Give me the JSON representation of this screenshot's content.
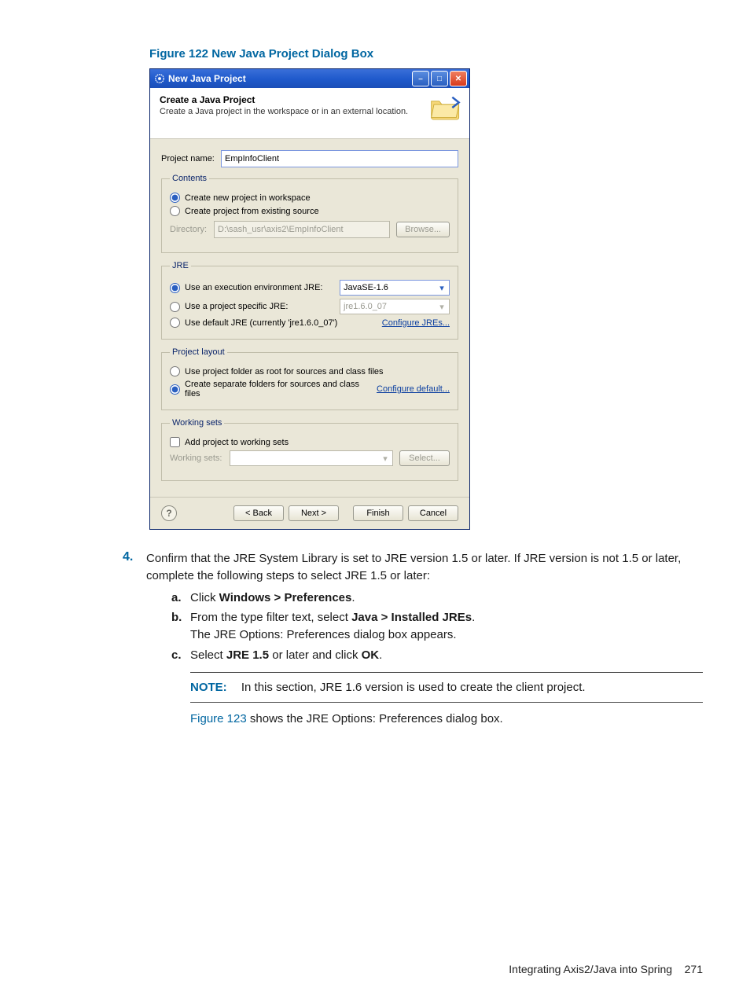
{
  "figure_caption": "Figure 122 New Java Project Dialog Box",
  "dialog": {
    "window_title": "New Java Project",
    "banner_title": "Create a Java Project",
    "banner_subtitle": "Create a Java project in the workspace or in an external location.",
    "project_name_label": "Project name:",
    "project_name_value": "EmpInfoClient",
    "contents": {
      "legend": "Contents",
      "opt_new": "Create new project in workspace",
      "opt_existing": "Create project from existing source",
      "directory_label": "Directory:",
      "directory_value": "D:\\sash_usr\\axis2\\EmpInfoClient",
      "browse": "Browse..."
    },
    "jre": {
      "legend": "JRE",
      "opt_exec_env": "Use an execution environment JRE:",
      "exec_env_value": "JavaSE-1.6",
      "opt_proj_specific": "Use a project specific JRE:",
      "proj_specific_value": "jre1.6.0_07",
      "opt_default": "Use default JRE (currently 'jre1.6.0_07')",
      "configure": "Configure JREs..."
    },
    "layout": {
      "legend": "Project layout",
      "opt_root": "Use project folder as root for sources and class files",
      "opt_separate": "Create separate folders for sources and class files",
      "configure": "Configure default..."
    },
    "ws": {
      "legend": "Working sets",
      "chk_add": "Add project to working sets",
      "label": "Working sets:",
      "select": "Select..."
    },
    "buttons": {
      "back": "< Back",
      "next": "Next >",
      "finish": "Finish",
      "cancel": "Cancel"
    }
  },
  "doc": {
    "step_num": "4.",
    "step_text_a": "Confirm that the JRE System Library is set to JRE version 1.5 or later. If JRE version is not 1.5 or later, complete the following steps to select JRE 1.5 or later:",
    "sub_a_num": "a.",
    "sub_a_pre": "Click ",
    "sub_a_bold": "Windows > Preferences",
    "sub_a_post": ".",
    "sub_b_num": "b.",
    "sub_b_pre": "From the type filter text, select ",
    "sub_b_bold": "Java > Installed JREs",
    "sub_b_post": ".",
    "sub_b_line2": "The JRE Options: Preferences dialog box appears.",
    "sub_c_num": "c.",
    "sub_c_pre": "Select ",
    "sub_c_bold1": "JRE 1.5",
    "sub_c_mid": " or later and click ",
    "sub_c_bold2": "OK",
    "sub_c_post": ".",
    "note_label": "NOTE:",
    "note_text": "In this section, JRE 1.6 version is used to create the client project.",
    "after_note_link": "Figure 123",
    "after_note_rest": " shows the JRE Options: Preferences dialog box."
  },
  "footer": {
    "text": "Integrating Axis2/Java into Spring",
    "page": "271"
  }
}
